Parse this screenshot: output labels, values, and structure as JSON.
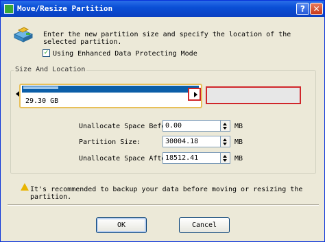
{
  "window": {
    "title": "Move/Resize Partition",
    "help_glyph": "?",
    "close_glyph": "✕"
  },
  "intro": "Enter the new partition size and specify the location of the selected partition.",
  "option": {
    "label": "Using Enhanced Data Protecting Mode",
    "checked": true,
    "check_glyph": "✓"
  },
  "group": {
    "title": "Size And Location"
  },
  "partition": {
    "size_label": "29.30 GB",
    "used_fraction": 0.2
  },
  "fields": [
    {
      "label": "Unallocate Space Before:",
      "value": "0.00",
      "unit": "MB"
    },
    {
      "label": "Partition Size:",
      "value": "30004.18",
      "unit": "MB"
    },
    {
      "label": "Unallocate Space After:",
      "value": "18512.41",
      "unit": "MB"
    }
  ],
  "warning": "It's recommended to backup your data before moving or resizing the partition.",
  "buttons": {
    "ok": "OK",
    "cancel": "Cancel"
  },
  "colors": {
    "title_bar": "#0a4fd6",
    "partition_bar": "#0b5ea8",
    "selection_border": "#d0262a",
    "warning_icon": "#e8b400"
  }
}
